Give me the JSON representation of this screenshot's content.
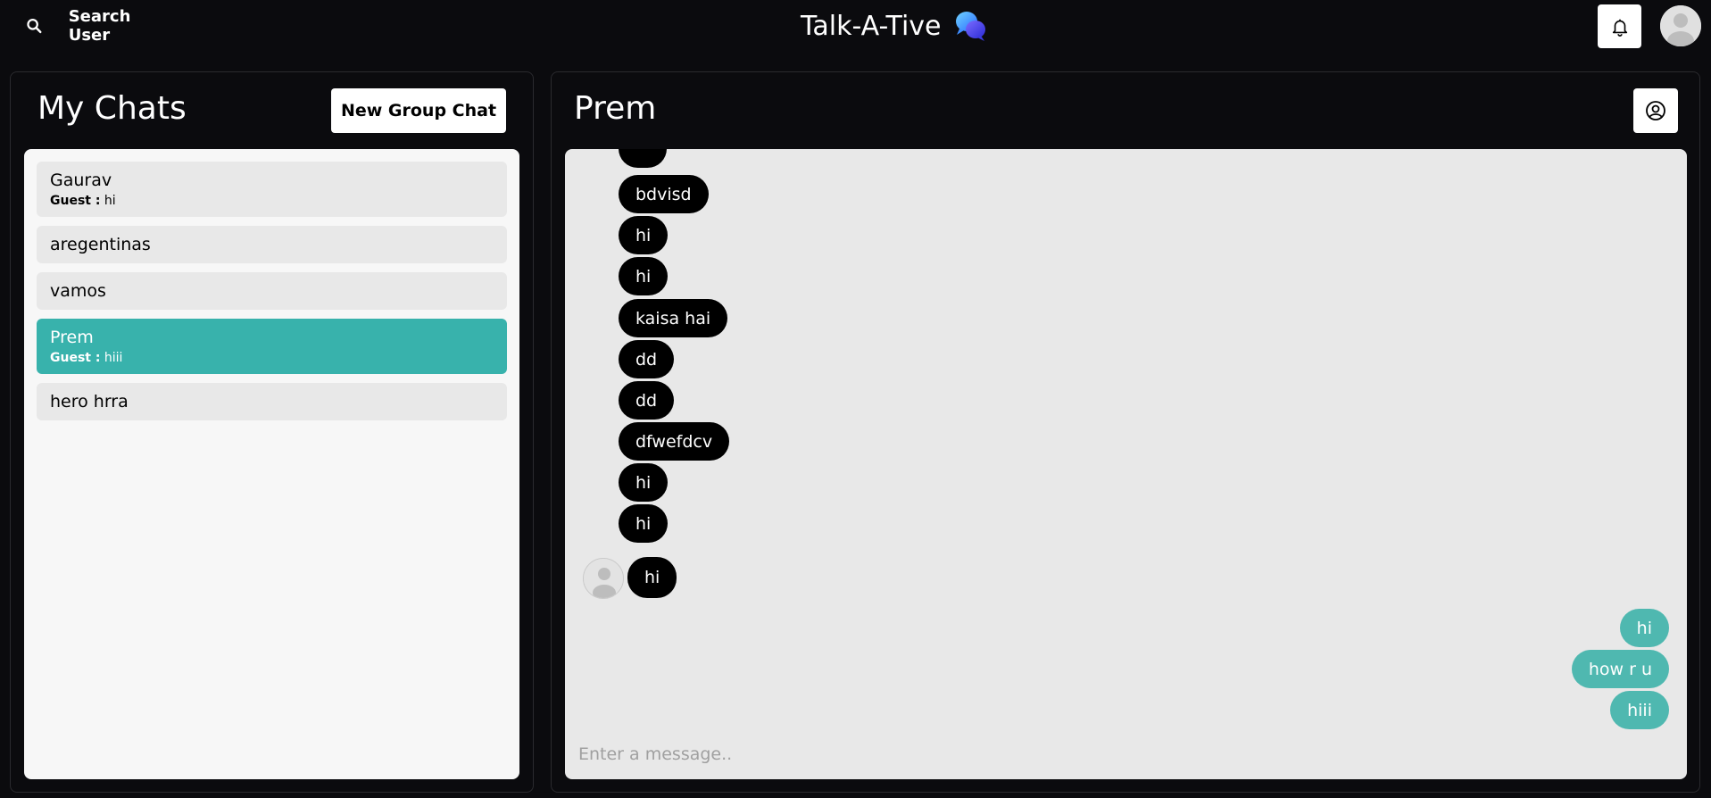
{
  "topbar": {
    "search_label": "Search User",
    "app_title": "Talk-A-Tive"
  },
  "sidebar": {
    "title": "My Chats",
    "new_group_label": "New Group Chat",
    "chats": [
      {
        "name": "Gaurav",
        "latest_sender": "Guest :",
        "latest_message": "hi",
        "selected": false
      },
      {
        "name": "aregentinas",
        "latest_sender": "",
        "latest_message": "",
        "selected": false
      },
      {
        "name": "vamos",
        "latest_sender": "",
        "latest_message": "",
        "selected": false
      },
      {
        "name": "Prem",
        "latest_sender": "Guest :",
        "latest_message": "hiii",
        "selected": true
      },
      {
        "name": "hero hrra",
        "latest_sender": "",
        "latest_message": "",
        "selected": false
      }
    ]
  },
  "chat": {
    "title": "Prem",
    "messages": [
      {
        "text": "",
        "side": "left"
      },
      {
        "text": "bdvisd",
        "side": "left"
      },
      {
        "text": "hi",
        "side": "left"
      },
      {
        "text": "hi",
        "side": "left"
      },
      {
        "text": "kaisa hai",
        "side": "left"
      },
      {
        "text": "dd",
        "side": "left"
      },
      {
        "text": "dd",
        "side": "left"
      },
      {
        "text": "dfwefdcv",
        "side": "left"
      },
      {
        "text": "hi",
        "side": "left"
      },
      {
        "text": "hi",
        "side": "left"
      },
      {
        "text": "hi",
        "side": "left"
      },
      {
        "text": "hi",
        "side": "right"
      },
      {
        "text": "how r u",
        "side": "right"
      },
      {
        "text": "hiii",
        "side": "right"
      }
    ],
    "input_placeholder": "Enter a message.."
  },
  "colors": {
    "background": "#0b0b0e",
    "accent": "#38b2ac",
    "outgoing_bubble": "#4fb8b0",
    "incoming_bubble": "#000000"
  }
}
